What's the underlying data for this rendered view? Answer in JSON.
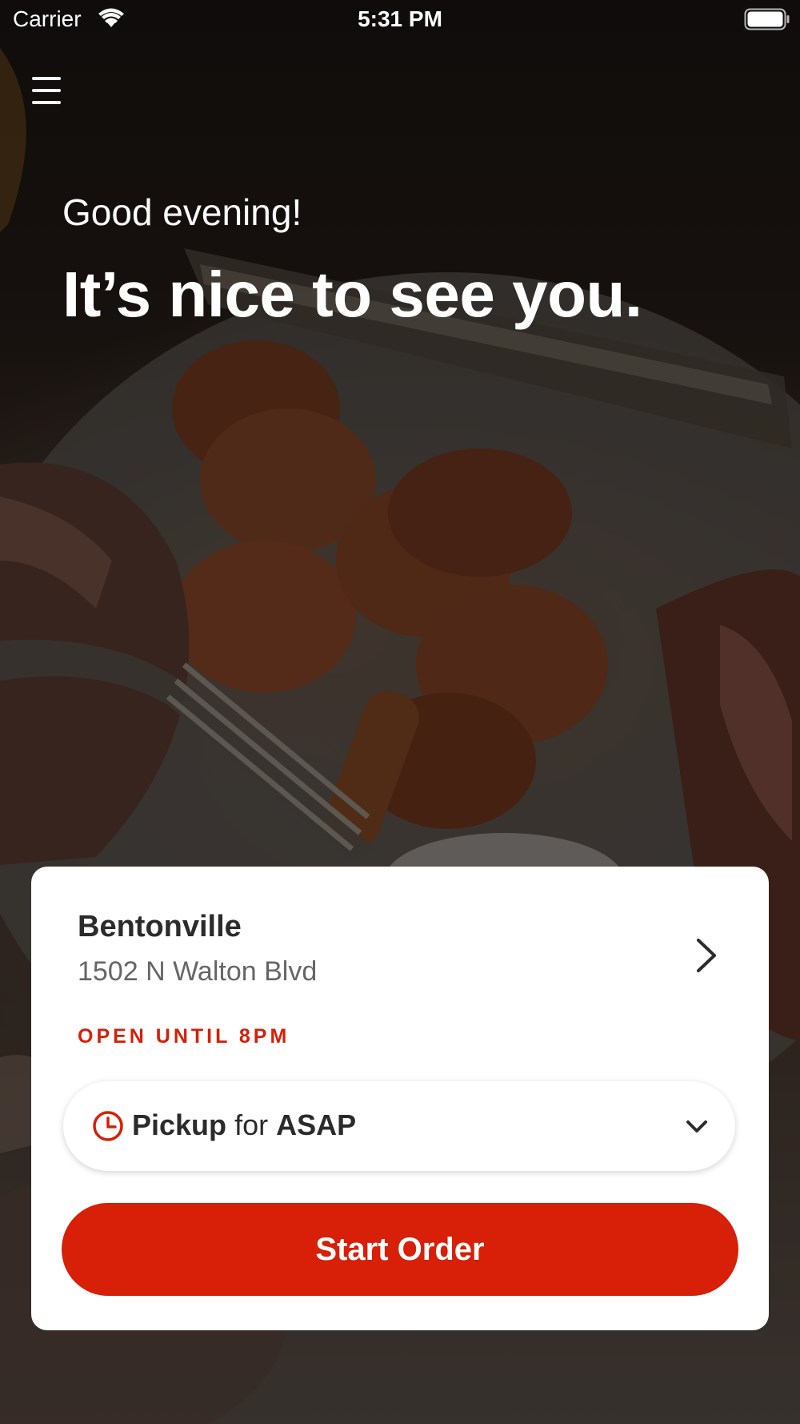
{
  "status_bar": {
    "carrier": "Carrier",
    "time": "5:31 PM",
    "wifi_icon": "wifi-icon",
    "battery_icon": "battery-icon"
  },
  "header": {
    "menu_icon": "hamburger-menu-icon",
    "greeting": "Good evening!",
    "headline": "It’s nice to see you."
  },
  "location_card": {
    "store_name": "Bentonville",
    "address": "1502 N Walton Blvd",
    "open_status": "OPEN UNTIL 8PM",
    "pickup": {
      "mode": "Pickup",
      "connector": "for",
      "time": "ASAP",
      "icon": "clock-icon"
    },
    "start_button_label": "Start Order"
  },
  "colors": {
    "accent": "#d81f08",
    "open_status": "#d41f0a",
    "card_background": "#ffffff"
  }
}
